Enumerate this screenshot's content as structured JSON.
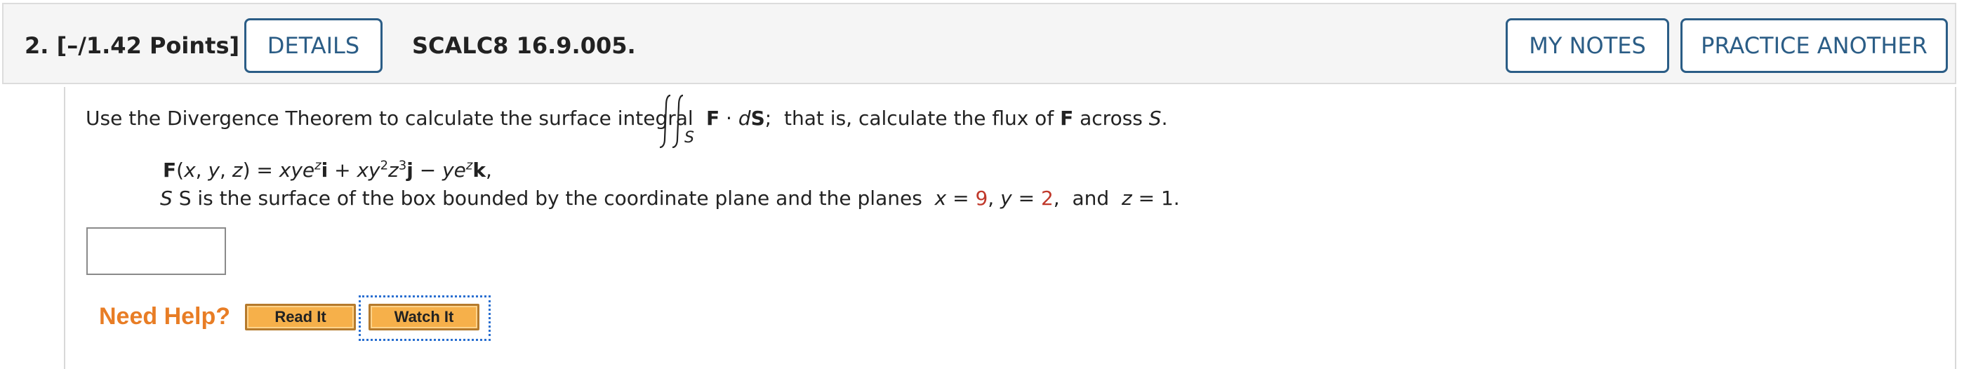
{
  "header": {
    "question_label": "2.  [–/1.42 Points]",
    "details_label": "DETAILS",
    "code": "SCALC8 16.9.005.",
    "my_notes_label": "MY NOTES",
    "practice_label": "PRACTICE ANOTHER"
  },
  "problem": {
    "intro": "Use the Divergence Theorem to calculate the surface integral",
    "integral_sub": "S",
    "after_integral": "F · dS;  that is, calculate the flux of F across S.",
    "field_eq": "F(x, y, z) = xye^z i + xy^2 z^3 j − ye^z k,",
    "surface_text": "S is the surface of the box bounded by the coordinate plane and the planes",
    "x_val": "9",
    "y_val": "2",
    "z_val": "1"
  },
  "help": {
    "label": "Need Help?",
    "read_label": "Read It",
    "watch_label": "Watch It"
  },
  "colors": {
    "accent": "#2b5d86",
    "help_orange": "#e87d25",
    "value_red": "#c0392b"
  }
}
